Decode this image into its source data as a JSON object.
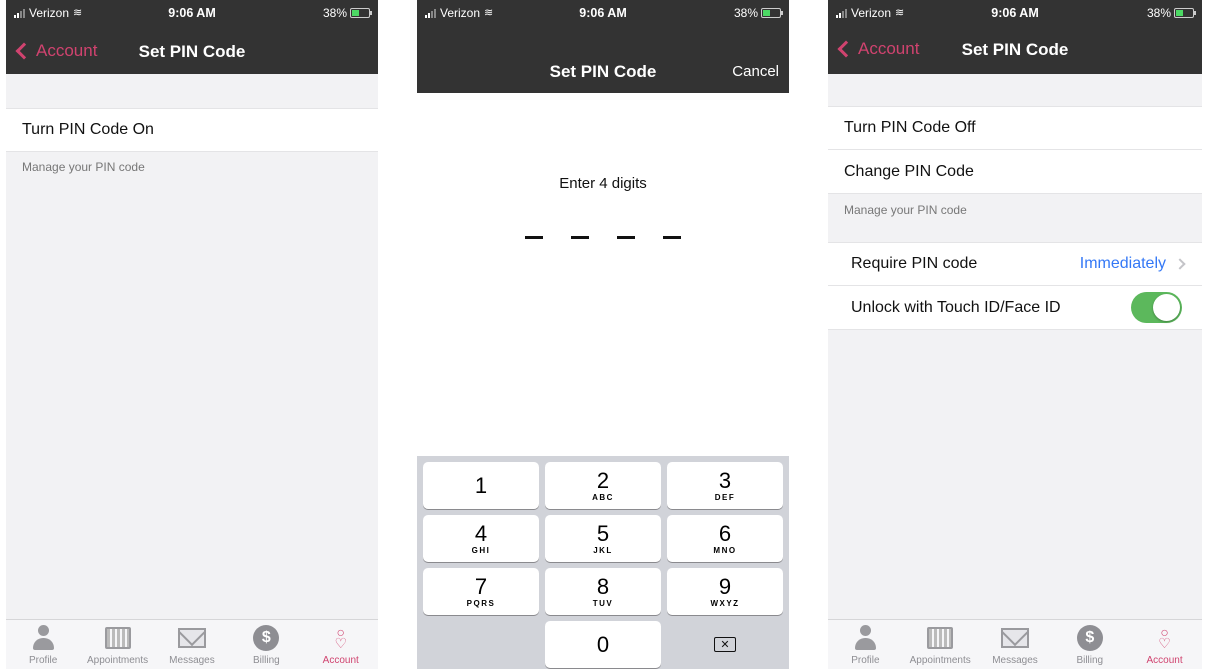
{
  "status": {
    "carrier": "Verizon",
    "time": "9:06 AM",
    "battery": "38%"
  },
  "screen1": {
    "back_label": "Account",
    "title": "Set PIN Code",
    "rows": [
      "Turn PIN Code On"
    ],
    "footer": "Manage your PIN code"
  },
  "screen2": {
    "title": "Set PIN Code",
    "cancel": "Cancel",
    "prompt": "Enter 4 digits",
    "keys": [
      {
        "digit": "1",
        "letters": ""
      },
      {
        "digit": "2",
        "letters": "ABC"
      },
      {
        "digit": "3",
        "letters": "DEF"
      },
      {
        "digit": "4",
        "letters": "GHI"
      },
      {
        "digit": "5",
        "letters": "JKL"
      },
      {
        "digit": "6",
        "letters": "MNO"
      },
      {
        "digit": "7",
        "letters": "PQRS"
      },
      {
        "digit": "8",
        "letters": "TUV"
      },
      {
        "digit": "9",
        "letters": "WXYZ"
      },
      {
        "digit": "0",
        "letters": ""
      }
    ]
  },
  "screen3": {
    "back_label": "Account",
    "title": "Set PIN Code",
    "rows": [
      "Turn PIN Code Off",
      "Change PIN Code"
    ],
    "footer": "Manage your PIN code",
    "require_label": "Require PIN code",
    "require_value": "Immediately",
    "touch_label": "Unlock with Touch ID/Face ID",
    "touch_enabled": true
  },
  "tabs": [
    "Profile",
    "Appointments",
    "Messages",
    "Billing",
    "Account"
  ],
  "colors": {
    "accent": "#d0436f",
    "link": "#3478f6",
    "toggle_on": "#5cb85c",
    "header": "#333333"
  }
}
